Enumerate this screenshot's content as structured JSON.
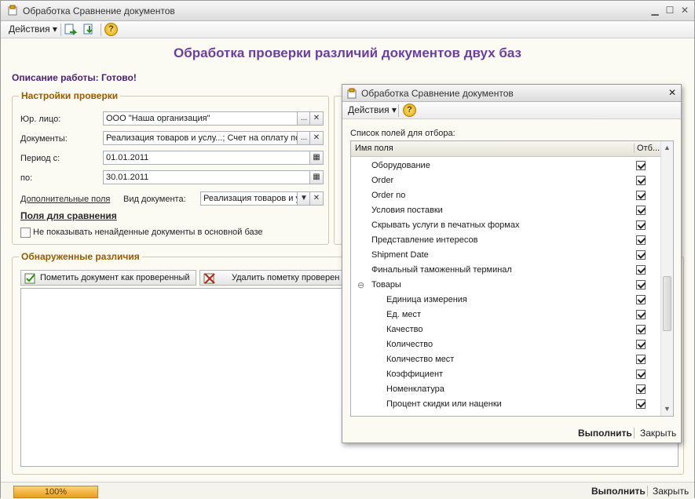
{
  "window": {
    "title": "Обработка  Сравнение документов",
    "actions_label": "Действия",
    "help_symbol": "?"
  },
  "heading": "Обработка проверки различий документов двух баз",
  "description": "Описание работы: Готово!",
  "settings": {
    "group_title": "Настройки проверки",
    "org_label": "Юр. лицо:",
    "org_value": "ООО \"Наша организация\"",
    "docs_label": "Документы:",
    "docs_value": "Реализация товаров и услу...; Счет на оплату по",
    "period_from_label": "Период с:",
    "period_from_value": "01.01.2011",
    "period_to_label": "по:",
    "period_to_value": "30.01.2011",
    "extra_fields_link": "Дополнительные поля",
    "doc_type_label": "Вид документа:",
    "doc_type_value": "Реализация товаров и у",
    "compare_fields_link": "Поля для сравнения",
    "hide_missing_label": "Не показывать ненайденные документы в основной базе",
    "ellipsis": "...",
    "clear": "✕"
  },
  "differences": {
    "group_title": "Обнаруженные различия",
    "mark_checked_button": "Пометить документ как проверенный",
    "remove_mark_button": "Удалить пометку проверен"
  },
  "footer": {
    "progress": "100%",
    "progress_fraction": 1.0,
    "run_label": "Выполнить",
    "close_label": "Закрыть"
  },
  "popup": {
    "title": "Обработка  Сравнение документов",
    "actions_label": "Действия",
    "list_caption": "Список полей для отбора:",
    "col_name": "Имя поля",
    "col_select": "Отб...",
    "collapse_symbol": "⊖",
    "run_label": "Выполнить",
    "close_label": "Закрыть",
    "rows": [
      {
        "name": "Оборудование",
        "level": 1,
        "checked": true
      },
      {
        "name": "Order",
        "level": 1,
        "checked": true
      },
      {
        "name": "Order no",
        "level": 1,
        "checked": true
      },
      {
        "name": "Условия поставки",
        "level": 1,
        "checked": true
      },
      {
        "name": "Скрывать услуги в печатных формах",
        "level": 1,
        "checked": true
      },
      {
        "name": "Представление интересов",
        "level": 1,
        "checked": true
      },
      {
        "name": "Shipment Date",
        "level": 1,
        "checked": true
      },
      {
        "name": "Финальный таможенный терминал",
        "level": 1,
        "checked": true
      },
      {
        "name": "Товары",
        "level": 1,
        "checked": true,
        "group": true
      },
      {
        "name": "Единица измерения",
        "level": 2,
        "checked": true
      },
      {
        "name": "Ед. мест",
        "level": 2,
        "checked": true
      },
      {
        "name": "Качество",
        "level": 2,
        "checked": true
      },
      {
        "name": "Количество",
        "level": 2,
        "checked": true
      },
      {
        "name": "Количество мест",
        "level": 2,
        "checked": true
      },
      {
        "name": "Коэффициент",
        "level": 2,
        "checked": true
      },
      {
        "name": "Номенклатура",
        "level": 2,
        "checked": true
      },
      {
        "name": "Процент скидки или наценки",
        "level": 2,
        "checked": true
      }
    ]
  }
}
